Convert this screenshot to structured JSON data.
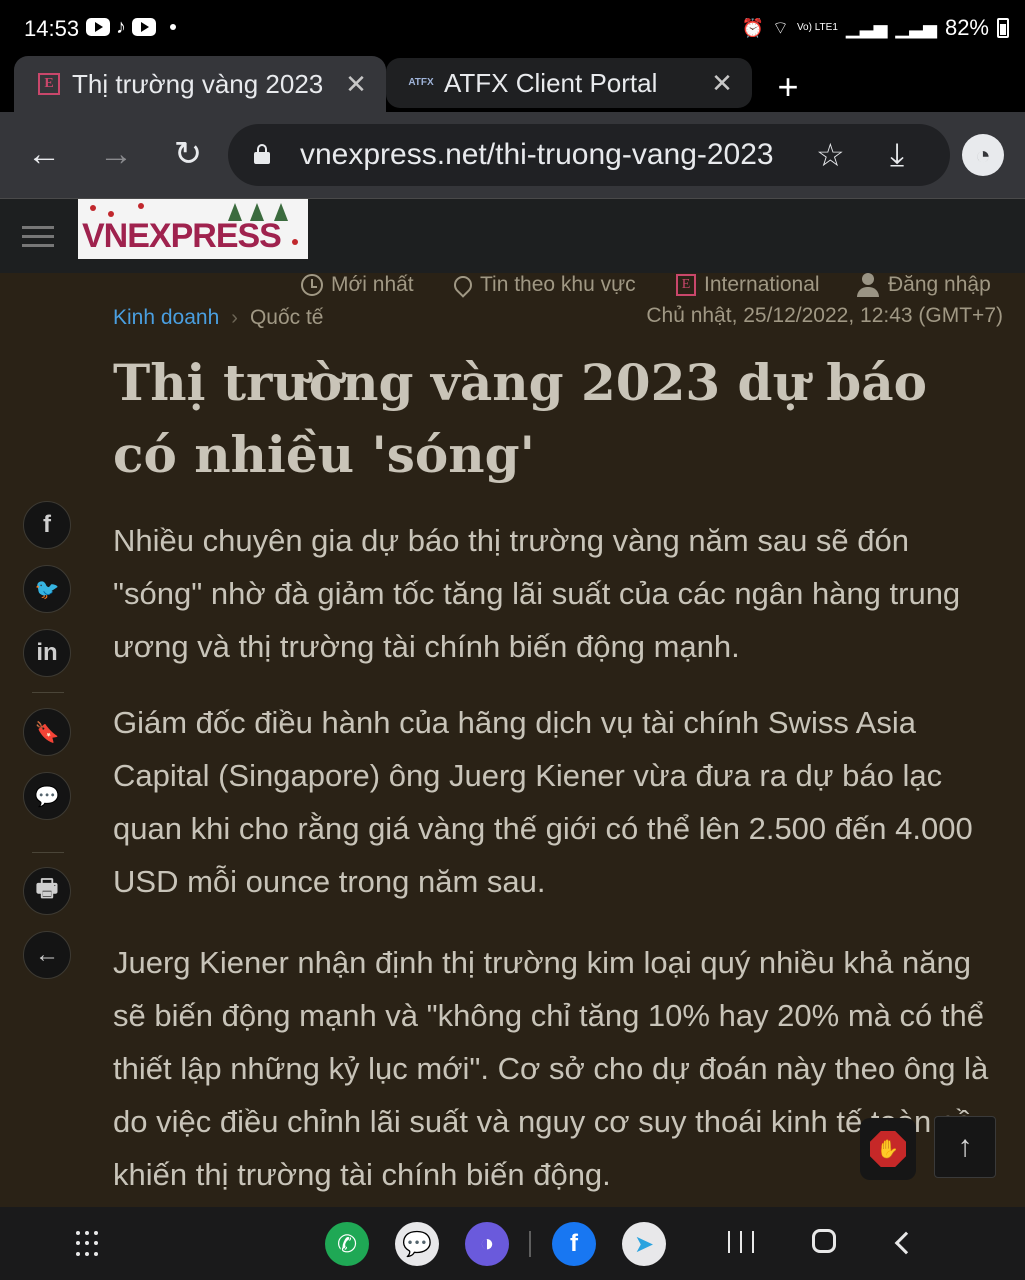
{
  "status": {
    "time": "14:53",
    "tiktok_glyph": "♪",
    "net": "Vo) LTE1",
    "battery": "82%"
  },
  "tabs": [
    {
      "title": "Thị trường vàng 2023",
      "favicon": "E",
      "close": "✕"
    },
    {
      "title": "ATFX Client Portal",
      "favicon": "ATFX",
      "close": "✕"
    }
  ],
  "new_tab_label": "+",
  "toolbar": {
    "back": "←",
    "forward": "→",
    "reload": "↻",
    "url": "vnexpress.net/thi-truong-vang-2023",
    "star": "☆",
    "download": "⤓",
    "extension": "◔"
  },
  "site": {
    "logo_text": "VNEXPRESS",
    "nav": [
      {
        "label": "Mới nhất",
        "icon": "clock-icon"
      },
      {
        "label": "Tin theo khu vực",
        "icon": "map-pin-icon"
      },
      {
        "label": "International",
        "icon": "e-logo-icon"
      },
      {
        "label": "Đăng nhập",
        "icon": "user-icon"
      }
    ],
    "international_glyph": "E"
  },
  "article": {
    "category": "Kinh doanh",
    "separator": "›",
    "subcategory": "Quốc tế",
    "date": "Chủ nhật, 25/12/2022, 12:43 (GMT+7)",
    "title": "Thị trường vàng 2023 dự báo có nhiều 'sóng'",
    "lead": "Nhiều chuyên gia dự báo thị trường vàng năm sau sẽ đón \"sóng\" nhờ đà giảm tốc tăng lãi suất của các ngân hàng trung ương và thị trường tài chính biến động mạnh.",
    "paragraphs": [
      "Giám đốc điều hành của hãng dịch vụ tài chính Swiss Asia Capital (Singapore) ông Juerg Kiener vừa đưa ra dự báo lạc quan khi cho rằng giá vàng thế giới có thể lên 2.500 đến 4.000 USD mỗi ounce trong năm sau.",
      "Juerg Kiener nhận định thị trường kim loại quý nhiều khả năng sẽ biến động mạnh và \"không chỉ tăng 10% hay 20% mà có thể thiết lập những kỷ lục mới\". Cơ sở cho dự đoán này theo ông là do việc điều chỉnh lãi suất và nguy cơ suy thoái kinh tế toàn cầu khiến thị trường tài chính biến động."
    ]
  },
  "share_rail": [
    {
      "name": "facebook",
      "glyph": "f"
    },
    {
      "name": "twitter",
      "glyph": "🐦"
    },
    {
      "name": "linkedin",
      "glyph": "in"
    },
    {
      "name": "bookmark",
      "glyph": "🔖"
    },
    {
      "name": "comment",
      "glyph": "💬"
    },
    {
      "name": "print",
      "glyph": "🖶"
    },
    {
      "name": "back",
      "glyph": "←"
    }
  ],
  "floating": {
    "adblock_glyph": "✋",
    "scroll_top_glyph": "↑"
  },
  "navbar_apps": [
    {
      "name": "phone",
      "color": "#1fa855",
      "glyph": "✆"
    },
    {
      "name": "messages",
      "color": "#e8e8ea",
      "glyph": "💬"
    },
    {
      "name": "internet",
      "color": "#6a5adc",
      "glyph": "◑"
    },
    {
      "name": "facebook",
      "color": "#1877f2",
      "glyph": "f"
    },
    {
      "name": "telegram",
      "color": "#e8e8ea",
      "glyph": "➤"
    }
  ],
  "colors": {
    "accent_link": "#4a9fe0",
    "page_bg": "#2a2216",
    "brand": "#9f224e"
  }
}
